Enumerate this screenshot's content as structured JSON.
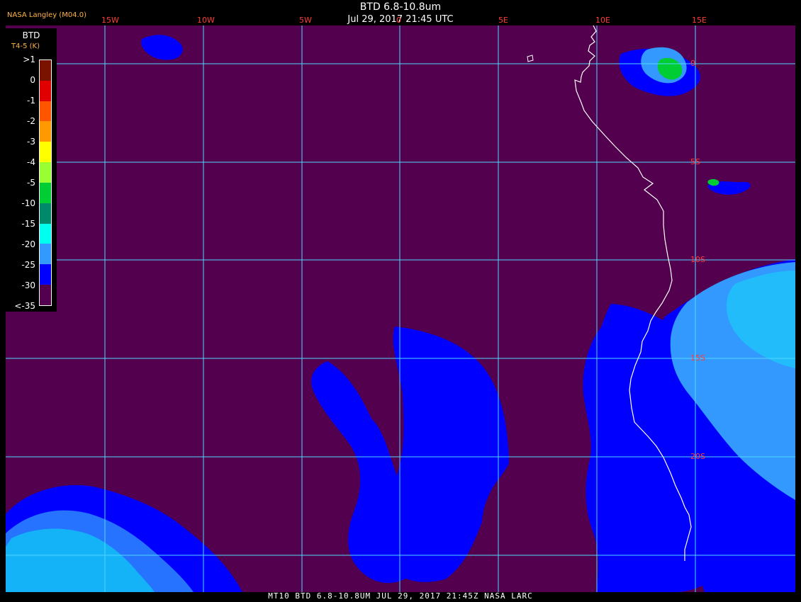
{
  "header": {
    "title": "BTD 6.8-10.8um",
    "datetime": "Jul 29, 2017 21:45 UTC",
    "source": "NASA Langley (M04.0)"
  },
  "legend": {
    "title": "BTD",
    "subtitle": "T4-5 (K)",
    "labels": [
      ">1",
      "0",
      "-1",
      "-2",
      "-3",
      "-4",
      "-5",
      "-10",
      "-15",
      "-20",
      "-25",
      "-30",
      "<-35"
    ],
    "colors": [
      "#7a1200",
      "#e00000",
      "#ff5500",
      "#ff9900",
      "#ffff00",
      "#99ff33",
      "#00cc33",
      "#00886a",
      "#00ffee",
      "#3399ff",
      "#0000ff",
      "#53004f"
    ]
  },
  "grid": {
    "lon_labels": [
      "15W",
      "10W",
      "5W",
      "0",
      "5E",
      "10E",
      "15E"
    ],
    "lat_labels": [
      "0",
      "5S",
      "10S",
      "15S",
      "20S"
    ],
    "lon_values_deg": [
      -15,
      -10,
      -5,
      0,
      5,
      10,
      15
    ],
    "lat_values_deg": [
      0,
      -5,
      -10,
      -15,
      -20
    ]
  },
  "colors": {
    "background": "#000000",
    "ocean_clear": "#53004f",
    "grid_line": "#4fd8ff",
    "coast": "#ffffff",
    "label_red": "#ff3b3b",
    "label_orange": "#ffb347"
  },
  "footer": {
    "text": "MT10  BTD 6.8-10.8UM   JUL 29, 2017 21:45Z   NASA LARC"
  }
}
